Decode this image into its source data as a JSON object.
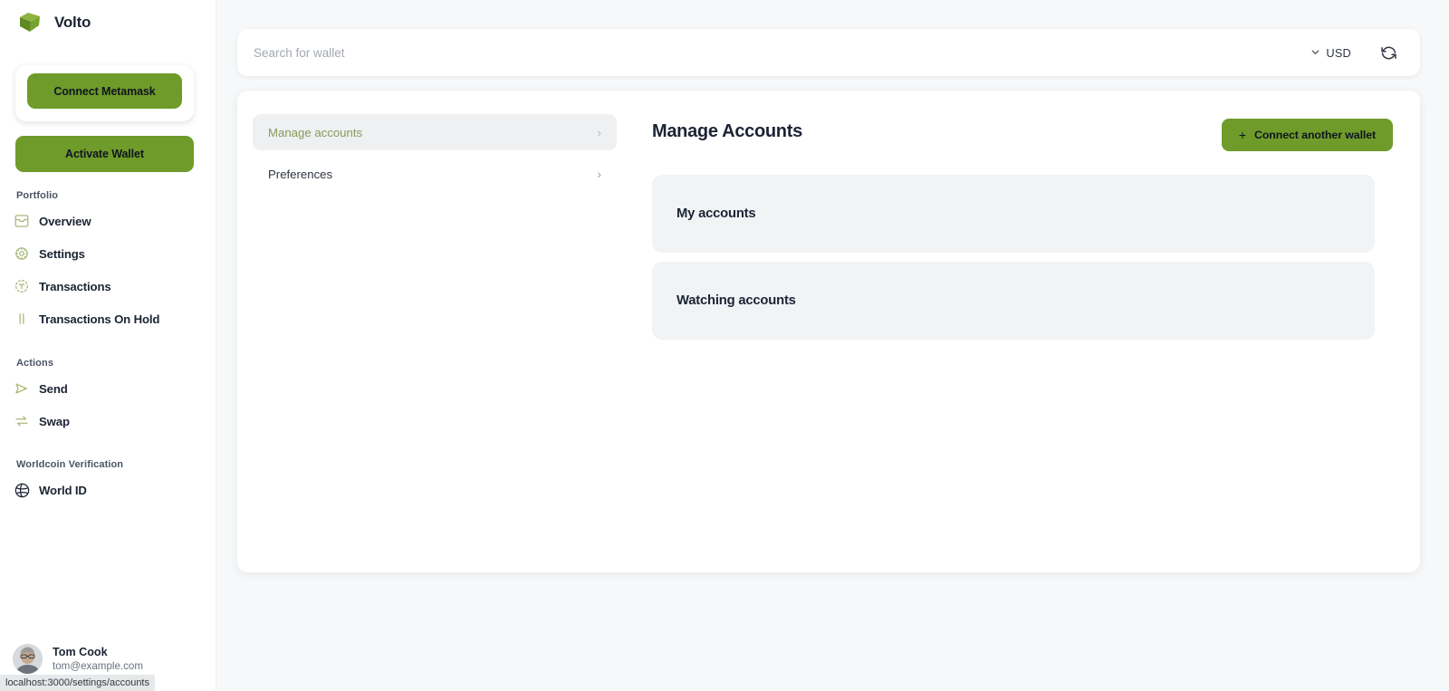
{
  "brand": {
    "name": "Volto",
    "logo_icon": "volto-cube-logo"
  },
  "sidebar": {
    "connect_metamask_label": "Connect Metamask",
    "activate_wallet_label": "Activate Wallet",
    "sections": [
      {
        "label": "Portfolio",
        "items": [
          {
            "label": "Overview",
            "icon": "inbox-icon"
          },
          {
            "label": "Settings",
            "icon": "gear-icon"
          },
          {
            "label": "Transactions",
            "icon": "dashed-circle-icon"
          },
          {
            "label": "Transactions On Hold",
            "icon": "pause-icon"
          }
        ]
      },
      {
        "label": "Actions",
        "items": [
          {
            "label": "Send",
            "icon": "send-icon"
          },
          {
            "label": "Swap",
            "icon": "swap-icon"
          }
        ]
      },
      {
        "label": "Worldcoin Verification",
        "items": [
          {
            "label": "World ID",
            "icon": "world-id-globe-icon"
          }
        ]
      }
    ],
    "profile": {
      "name": "Tom Cook",
      "email": "tom@example.com",
      "avatar_icon": "user-avatar-photo"
    }
  },
  "topbar": {
    "search_placeholder": "Search for wallet",
    "search_value": "",
    "currency": "USD",
    "currency_chevron_icon": "chevron-down-icon",
    "refresh_icon": "refresh-icon"
  },
  "settings_nav": {
    "items": [
      {
        "label": "Manage accounts",
        "chevron": "›",
        "active": true
      },
      {
        "label": "Preferences",
        "chevron": "›",
        "active": false
      }
    ]
  },
  "main": {
    "title": "Manage Accounts",
    "connect_wallet_label": "Connect another wallet",
    "plus_icon": "+",
    "groups": [
      {
        "title": "My accounts"
      },
      {
        "title": "Watching accounts"
      }
    ]
  },
  "status_bar": {
    "url": "localhost:3000/settings/accounts"
  },
  "colors": {
    "accent_green": "#6f9b2a",
    "icon_olive": "#a8b879",
    "page_bg": "#f7f8f9",
    "panel_bg": "#f1f3f5",
    "active_nav_bg": "#eef0f2",
    "active_nav_text": "#8a9a5b"
  }
}
